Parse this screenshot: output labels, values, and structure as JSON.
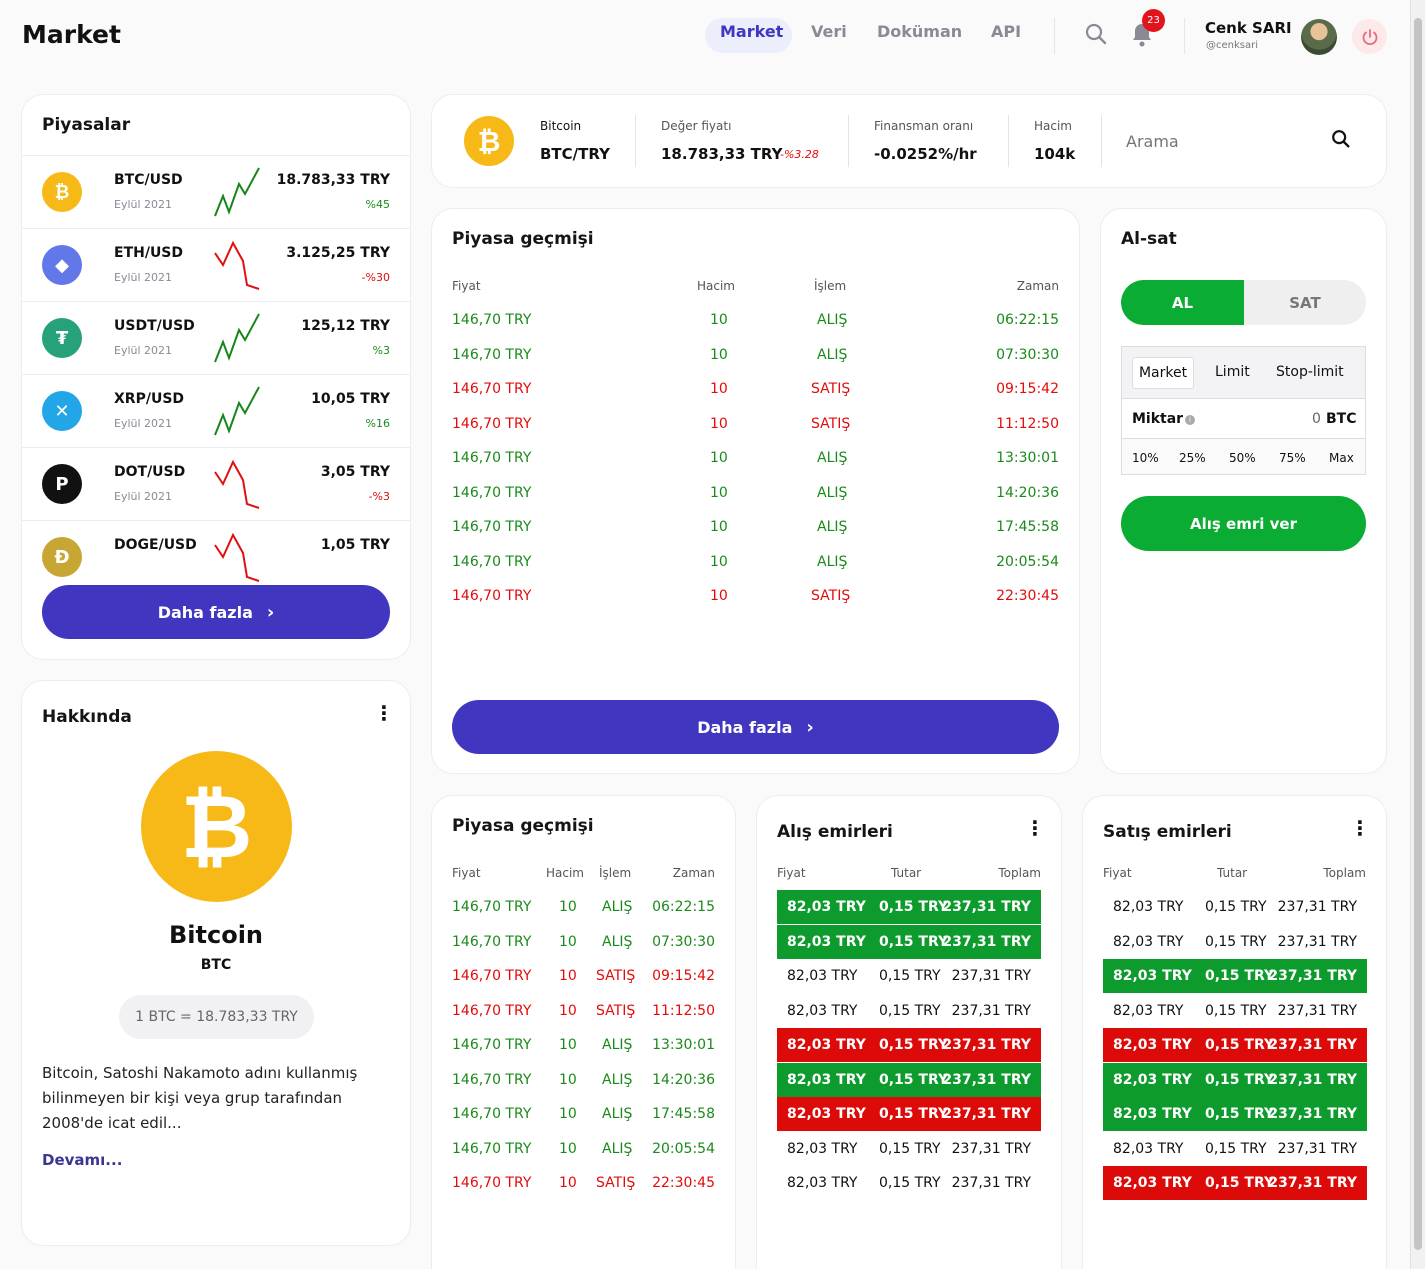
{
  "header": {
    "title": "Market",
    "nav": [
      "Market",
      "Veri",
      "Doküman",
      "API"
    ],
    "notifications": "23",
    "user_name": "Cenk SARI",
    "user_handle": "@cenksari"
  },
  "markets": {
    "title": "Piyasalar",
    "items": [
      {
        "symbol": "BTC/USD",
        "date": "Eylül 2021",
        "price": "18.783,33 TRY",
        "change": "%45",
        "trend": "up",
        "icon": "bitcoin-icon",
        "color": "#f7b918",
        "glyph": "₿"
      },
      {
        "symbol": "ETH/USD",
        "date": "Eylül 2021",
        "price": "3.125,25 TRY",
        "change": "-%30",
        "trend": "down",
        "icon": "ethereum-icon",
        "color": "#6278e8",
        "glyph": "◆"
      },
      {
        "symbol": "USDT/USD",
        "date": "Eylül 2021",
        "price": "125,12 TRY",
        "change": "%3",
        "trend": "up",
        "icon": "tether-icon",
        "color": "#26a17b",
        "glyph": "₮"
      },
      {
        "symbol": "XRP/USD",
        "date": "Eylül 2021",
        "price": "10,05 TRY",
        "change": "%16",
        "trend": "up",
        "icon": "xrp-icon",
        "color": "#23a6e8",
        "glyph": "✕"
      },
      {
        "symbol": "DOT/USD",
        "date": "Eylül 2021",
        "price": "3,05 TRY",
        "change": "-%3",
        "trend": "down",
        "icon": "polkadot-icon",
        "color": "#111111",
        "glyph": "P"
      },
      {
        "symbol": "DOGE/USD",
        "date": "",
        "price": "1,05 TRY",
        "change": "",
        "trend": "down",
        "icon": "doge-icon",
        "color": "#c8a633",
        "glyph": "Ð"
      }
    ],
    "more_label": "Daha fazla"
  },
  "about": {
    "title": "Hakkında",
    "coin_name": "Bitcoin",
    "coin_symbol": "BTC",
    "rate": "1 BTC = 18.783,33 TRY",
    "description": "Bitcoin, Satoshi Nakamoto adını kullanmış bilinmeyen bir kişi veya grup tarafından 2008'de icat edil...",
    "more_link": "Devamı..."
  },
  "ticker": {
    "coin_label": "Bitcoin",
    "pair": "BTC/TRY",
    "value_label": "Değer fiyatı",
    "value": "18.783,33 TRY",
    "value_change": "-%3.28",
    "funding_label": "Finansman oranı",
    "funding": "-0.0252%/hr",
    "volume_label": "Hacim",
    "volume": "104k",
    "search_placeholder": "Arama"
  },
  "history_main": {
    "title": "Piyasa geçmişi",
    "headers": [
      "Fiyat",
      "Hacim",
      "İşlem",
      "Zaman"
    ],
    "rows": [
      {
        "price": "146,70 TRY",
        "volume": "10",
        "type": "ALIŞ",
        "time": "06:22:15",
        "side": "buy"
      },
      {
        "price": "146,70 TRY",
        "volume": "10",
        "type": "ALIŞ",
        "time": "07:30:30",
        "side": "buy"
      },
      {
        "price": "146,70 TRY",
        "volume": "10",
        "type": "SATIŞ",
        "time": "09:15:42",
        "side": "sell"
      },
      {
        "price": "146,70 TRY",
        "volume": "10",
        "type": "SATIŞ",
        "time": "11:12:50",
        "side": "sell"
      },
      {
        "price": "146,70 TRY",
        "volume": "10",
        "type": "ALIŞ",
        "time": "13:30:01",
        "side": "buy"
      },
      {
        "price": "146,70 TRY",
        "volume": "10",
        "type": "ALIŞ",
        "time": "14:20:36",
        "side": "buy"
      },
      {
        "price": "146,70 TRY",
        "volume": "10",
        "type": "ALIŞ",
        "time": "17:45:58",
        "side": "buy"
      },
      {
        "price": "146,70 TRY",
        "volume": "10",
        "type": "ALIŞ",
        "time": "20:05:54",
        "side": "buy"
      },
      {
        "price": "146,70 TRY",
        "volume": "10",
        "type": "SATIŞ",
        "time": "22:30:45",
        "side": "sell"
      }
    ],
    "more_label": "Daha fazla"
  },
  "trade": {
    "title": "Al-sat",
    "buy_tab": "AL",
    "sell_tab": "SAT",
    "order_types": [
      "Market",
      "Limit",
      "Stop-limit"
    ],
    "amount_label": "Miktar",
    "amount_value": "0",
    "amount_unit": "BTC",
    "percents": [
      "10%",
      "25%",
      "50%",
      "75%",
      "Max"
    ],
    "submit_label": "Alış emri ver"
  },
  "history_small": {
    "title": "Piyasa geçmişi",
    "headers": [
      "Fiyat",
      "Hacim",
      "İşlem",
      "Zaman"
    ]
  },
  "buy_orders": {
    "title": "Alış emirleri",
    "headers": [
      "Fiyat",
      "Tutar",
      "Toplam"
    ],
    "rows": [
      {
        "price": "82,03 TRY",
        "amount": "0,15 TRY",
        "total": "237,31 TRY",
        "highlight": "green"
      },
      {
        "price": "82,03 TRY",
        "amount": "0,15 TRY",
        "total": "237,31 TRY",
        "highlight": "green"
      },
      {
        "price": "82,03 TRY",
        "amount": "0,15 TRY",
        "total": "237,31 TRY",
        "highlight": "none"
      },
      {
        "price": "82,03 TRY",
        "amount": "0,15 TRY",
        "total": "237,31 TRY",
        "highlight": "none"
      },
      {
        "price": "82,03 TRY",
        "amount": "0,15 TRY",
        "total": "237,31 TRY",
        "highlight": "red"
      },
      {
        "price": "82,03 TRY",
        "amount": "0,15 TRY",
        "total": "237,31 TRY",
        "highlight": "green"
      },
      {
        "price": "82,03 TRY",
        "amount": "0,15 TRY",
        "total": "237,31 TRY",
        "highlight": "red"
      },
      {
        "price": "82,03 TRY",
        "amount": "0,15 TRY",
        "total": "237,31 TRY",
        "highlight": "none"
      },
      {
        "price": "82,03 TRY",
        "amount": "0,15 TRY",
        "total": "237,31 TRY",
        "highlight": "none"
      }
    ]
  },
  "sell_orders": {
    "title": "Satış emirleri",
    "headers": [
      "Fiyat",
      "Tutar",
      "Toplam"
    ],
    "rows": [
      {
        "price": "82,03 TRY",
        "amount": "0,15 TRY",
        "total": "237,31 TRY",
        "highlight": "none"
      },
      {
        "price": "82,03 TRY",
        "amount": "0,15 TRY",
        "total": "237,31 TRY",
        "highlight": "none"
      },
      {
        "price": "82,03 TRY",
        "amount": "0,15 TRY",
        "total": "237,31 TRY",
        "highlight": "green"
      },
      {
        "price": "82,03 TRY",
        "amount": "0,15 TRY",
        "total": "237,31 TRY",
        "highlight": "none"
      },
      {
        "price": "82,03 TRY",
        "amount": "0,15 TRY",
        "total": "237,31 TRY",
        "highlight": "red"
      },
      {
        "price": "82,03 TRY",
        "amount": "0,15 TRY",
        "total": "237,31 TRY",
        "highlight": "green"
      },
      {
        "price": "82,03 TRY",
        "amount": "0,15 TRY",
        "total": "237,31 TRY",
        "highlight": "green"
      },
      {
        "price": "82,03 TRY",
        "amount": "0,15 TRY",
        "total": "237,31 TRY",
        "highlight": "none"
      },
      {
        "price": "82,03 TRY",
        "amount": "0,15 TRY",
        "total": "237,31 TRY",
        "highlight": "red"
      }
    ]
  },
  "colors": {
    "accent": "#4136bf",
    "buy": "#0e9b2e",
    "sell": "#dd0a0a",
    "bitcoin": "#f7b918"
  }
}
